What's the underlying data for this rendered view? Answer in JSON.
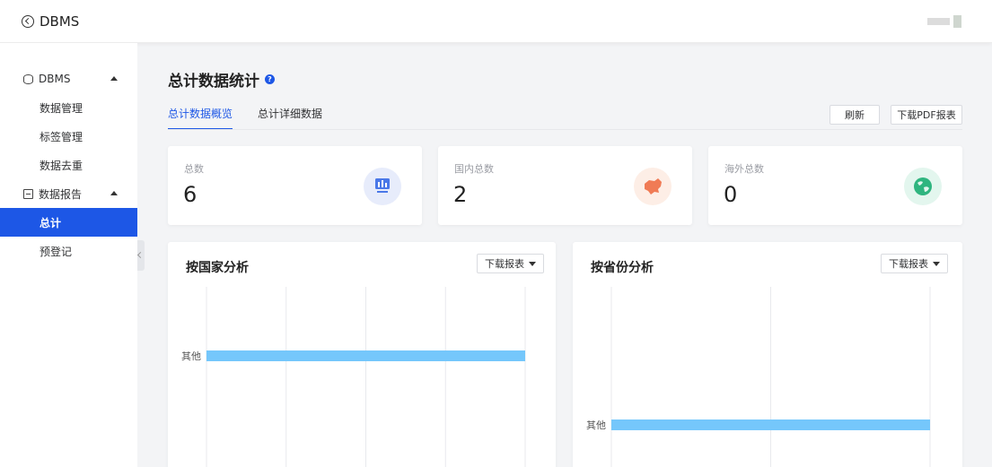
{
  "header": {
    "app_title": "DBMS"
  },
  "sidebar": {
    "groups": [
      {
        "label": "DBMS",
        "items": [
          "数据管理",
          "标签管理",
          "数据去重"
        ]
      },
      {
        "label": "数据报告",
        "items": [
          "总计",
          "预登记"
        ]
      }
    ],
    "active_item": "总计"
  },
  "main": {
    "title": "总计数据统计",
    "help_glyph": "?",
    "tabs": [
      {
        "label": "总计数据概览"
      },
      {
        "label": "总计详细数据"
      }
    ],
    "active_tab": "总计数据概览",
    "buttons": {
      "refresh": "刷新",
      "download_pdf": "下载PDF报表"
    },
    "stats": [
      {
        "label": "总数",
        "value": "6"
      },
      {
        "label": "国内总数",
        "value": "2"
      },
      {
        "label": "海外总数",
        "value": "0"
      }
    ],
    "accent_color": "#1d57e6"
  },
  "chart_data": [
    {
      "type": "bar",
      "orientation": "horizontal",
      "title": "按国家分析",
      "download_label": "下载报表",
      "categories": [
        "其他"
      ],
      "values": [
        4
      ],
      "color": "#75c7fb",
      "grid": true
    },
    {
      "type": "bar",
      "orientation": "horizontal",
      "title": "按省份分析",
      "download_label": "下载报表",
      "categories": [
        "其他"
      ],
      "values": [
        2
      ],
      "color": "#75c7fb",
      "grid": true
    }
  ]
}
